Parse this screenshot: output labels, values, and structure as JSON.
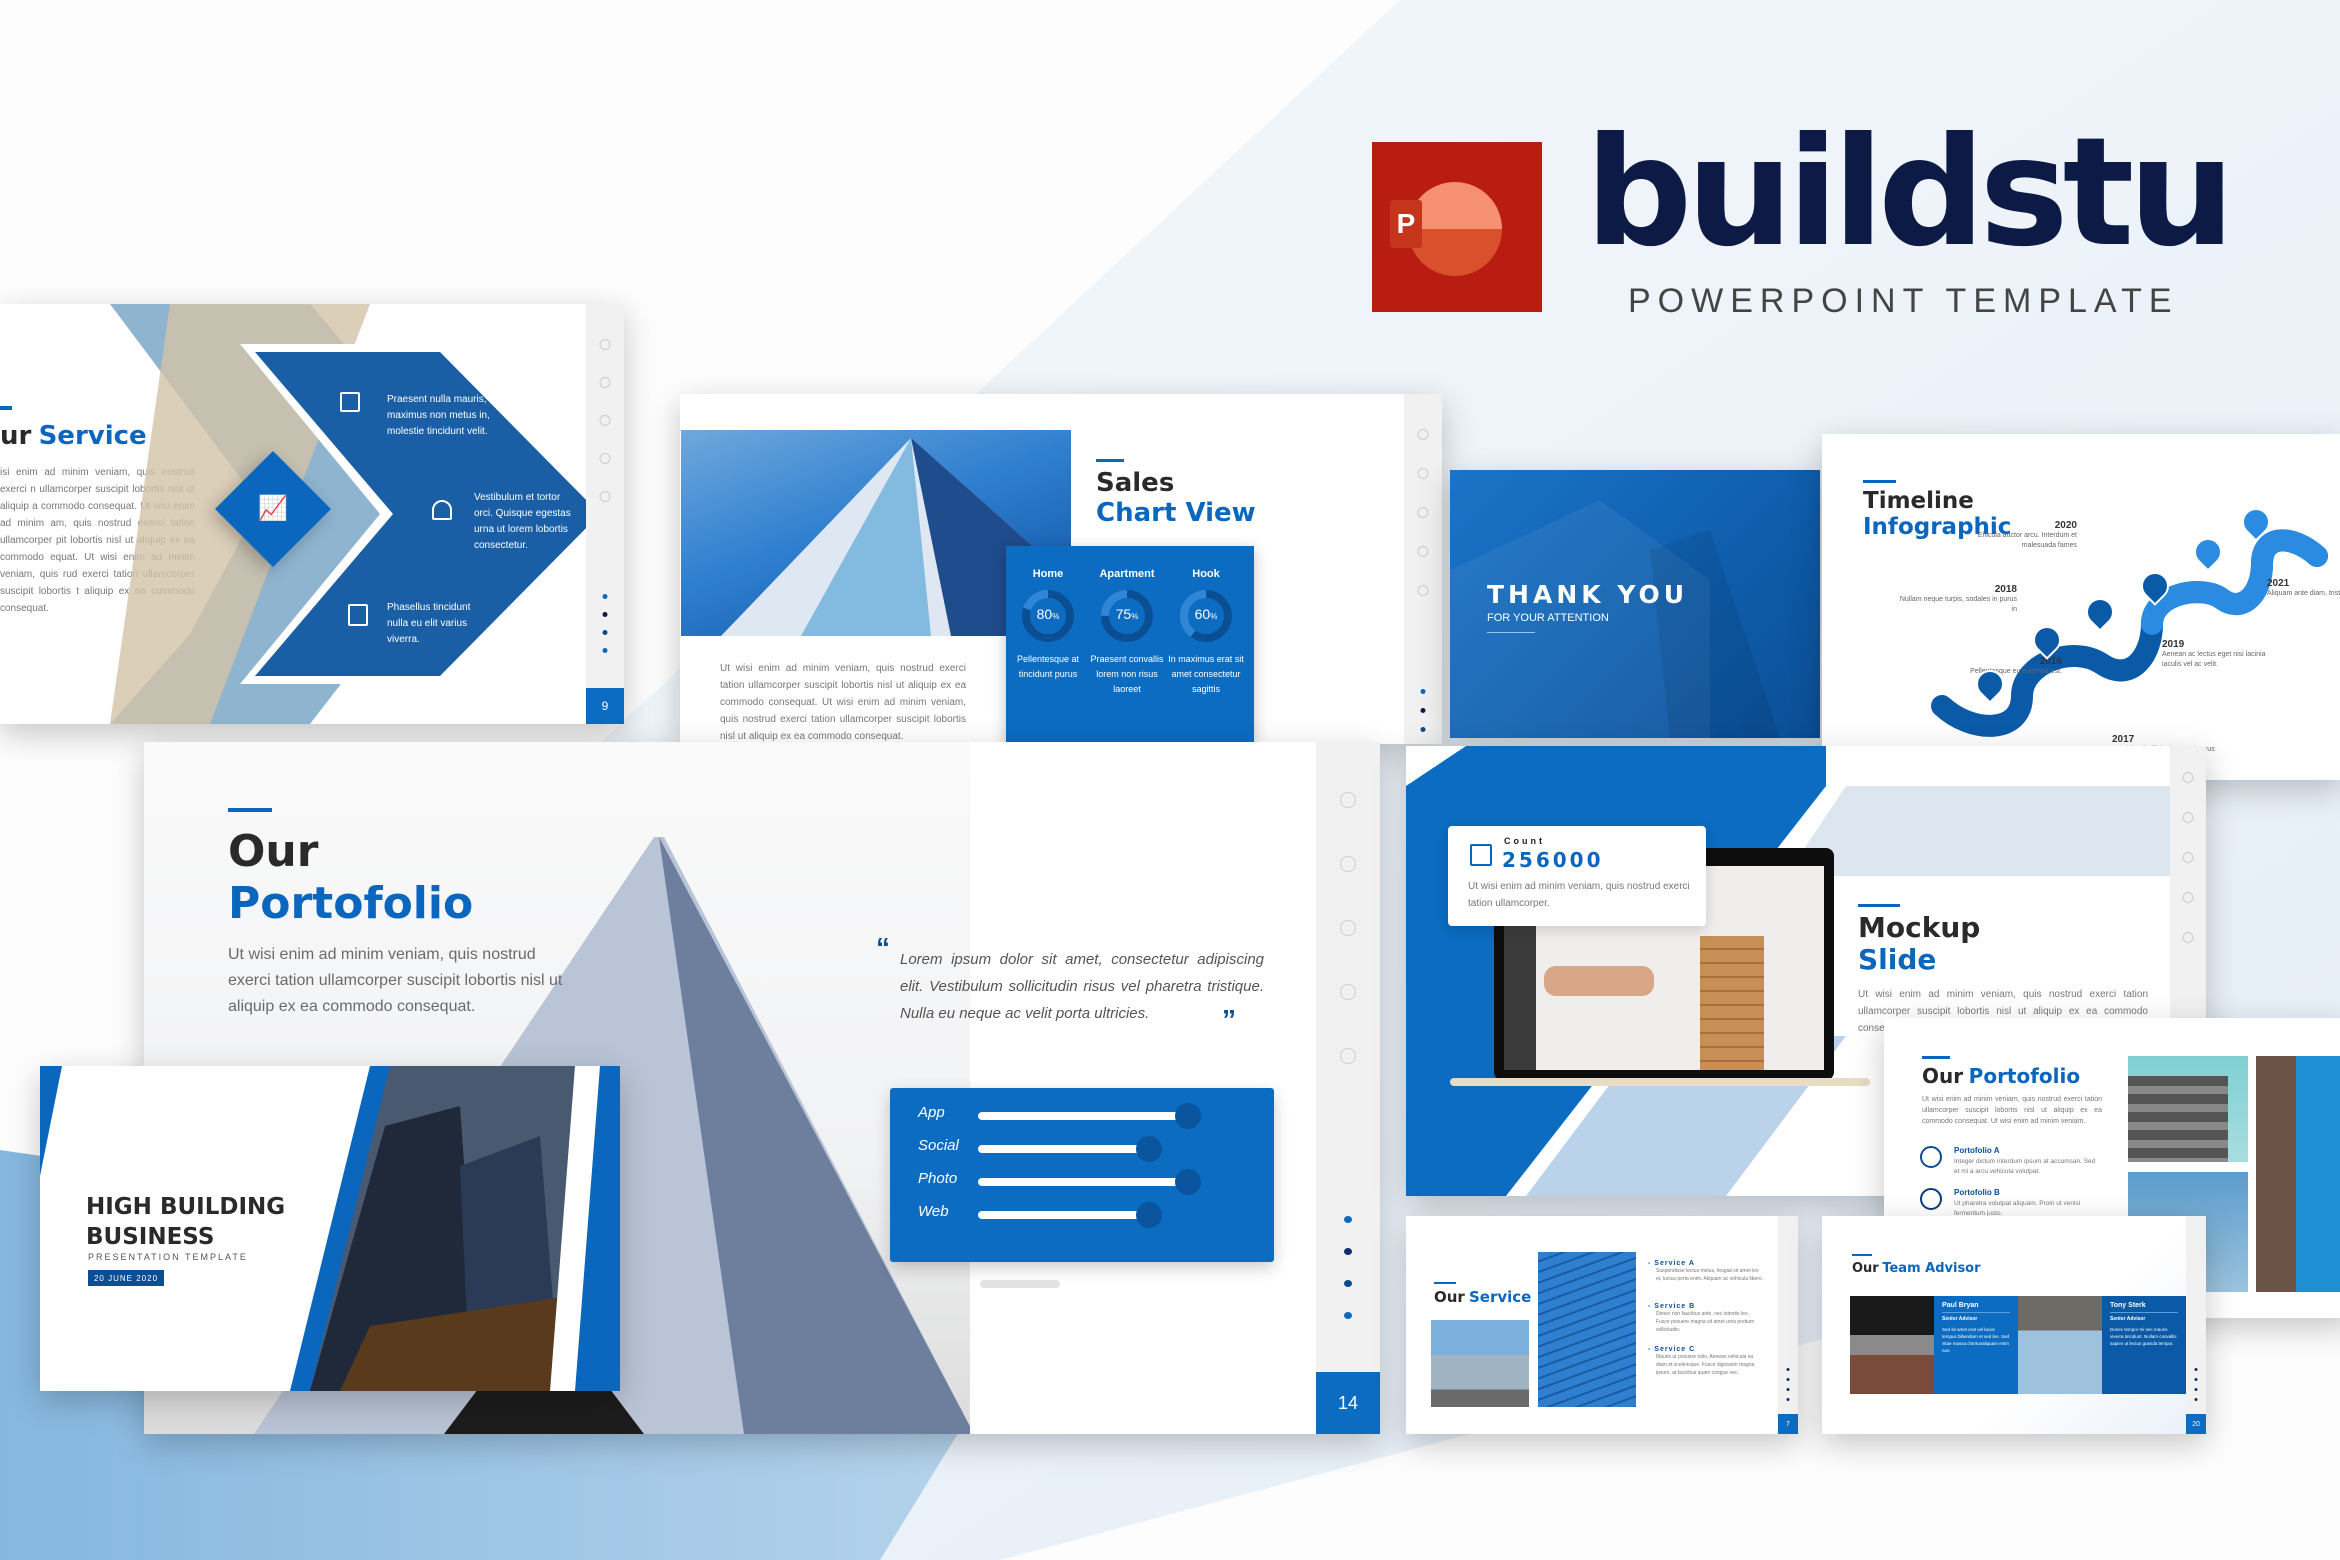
{
  "brand": {
    "app_icon": "powerpoint-icon",
    "app_icon_letter": "P",
    "name": "buildstu",
    "tagline": "POWERPOINT TEMPLATE",
    "colors": {
      "primary_blue": "#0b66be",
      "navy": "#0d1a45",
      "ppt_red": "#b91c10",
      "ppt_orange": "#f47b55"
    }
  },
  "slides": {
    "service_chevron": {
      "title_dark": "ur",
      "title_blue": "Service",
      "body": "isi enim ad minim veniam, quis nostrud exerci n ullamcorper suscipit lobortis nisl ut aliquip a commodo consequat. Ut wisi enim ad minim am, quis nostrud exerci tation ullamcorper pit lobortis nisl ut aliquip ex ea commodo equat. Ut wisi enim ad minim veniam, quis rud exerci tation ullamcorper suscipit lobortis t aliquip ex ea commodo consequat.",
      "features": [
        {
          "icon": "houses-icon",
          "text": "Praesent nulla mauris, maximus non metus in, molestie tincidunt velit."
        },
        {
          "icon": "house-search-icon",
          "text": "Vestibulum et tortor orci. Quisque egestas urna ut lorem lobortis consectetur."
        },
        {
          "icon": "location-doc-icon",
          "text": "Phasellus tincidunt nulla eu elit varius viverra."
        }
      ],
      "center_icon": "growth-chart-icon",
      "page_number": "9"
    },
    "sales_chart": {
      "title_dark": "Sales",
      "title_blue": "Chart View",
      "body": "Ut wisi enim ad minim veniam, quis nostrud exerci tation ullamcorper suscipit lobortis nisl ut aliquip ex ea commodo consequat. Ut wisi enim ad minim veniam, quis nostrud exerci tation ullamcorper suscipit lobortis nisl ut aliquip ex ea commodo consequat.",
      "gauges": [
        {
          "label": "Home",
          "value": 80,
          "display": "80",
          "unit": "%",
          "caption": "Pellentesque at tincidunt purus"
        },
        {
          "label": "Apartment",
          "value": 75,
          "display": "75",
          "unit": "%",
          "caption": "Praesent convallis lorem non risus laoreet"
        },
        {
          "label": "Hook",
          "value": 60,
          "display": "60",
          "unit": "%",
          "caption": "In maximus erat sit amet consectetur sagittis"
        }
      ]
    },
    "thank_you": {
      "title": "THANK YOU",
      "subtitle": "FOR YOUR ATTENTION"
    },
    "timeline": {
      "title_dark": "Timeline",
      "title_blue": "Infographic",
      "events": [
        {
          "year": "2016",
          "text": "Pellentesque eu euismod est.",
          "icon": "edit-doc-icon"
        },
        {
          "year": "2017",
          "text": "Curabitur facilisis risus sed purus blandit feugiat.",
          "icon": "house-search-icon"
        },
        {
          "year": "2018",
          "text": "Nullam neque turpis, sodales in purus in",
          "icon": "house-leaf-icon"
        },
        {
          "year": "2019",
          "text": "Aenean ac lectus eget nisi lacinia iaculis vel ac velit.",
          "icon": "home-icon"
        },
        {
          "year": "2020",
          "text": "Ehicula auctor arcu. Interdum et malesuada fames",
          "icon": "award-icon"
        },
        {
          "year": "2021",
          "text": "Aliquam ante diam, tristique.",
          "icon": "blueprint-icon"
        }
      ]
    },
    "portfolio_main": {
      "title_dark": "Our",
      "title_blue": "Portofolio",
      "body": "Ut wisi enim ad minim veniam, quis nostrud exerci tation ullamcorper suscipit lobortis nisl ut aliquip ex ea commodo consequat.",
      "quote": "Lorem ipsum dolor sit amet, consectetur adipiscing elit. Vestibulum sollicitudin risus vel pharetra tristique. Nulla eu neque ac velit porta ultricies.",
      "skills": [
        {
          "label": "App",
          "value": 0.9
        },
        {
          "label": "Social",
          "value": 0.73
        },
        {
          "label": "Photo",
          "value": 0.9
        },
        {
          "label": "Web",
          "value": 0.73
        }
      ],
      "social_icons": [
        "instagram-icon",
        "tumblr-icon",
        "pinterest-icon",
        "facebook-icon",
        "twitter-icon"
      ],
      "page_number": "14"
    },
    "cover": {
      "title_line1": "HIGH BUILDING",
      "title_line2": "BUSINESS",
      "subtitle": "PRESENTATION TEMPLATE",
      "date": "20 JUNE 2020"
    },
    "mockup": {
      "count_label": "Count",
      "count_value": "256000",
      "count_body": "Ut wisi enim ad minim veniam, quis nostrud exerci tation ullamcorper.",
      "title_dark": "Mockup",
      "title_blue": "Slide",
      "body": "Ut wisi enim ad minim veniam, quis nostrud exerci tation ullamcorper suscipit lobortis nisl ut aliquip ex ea commodo consequat."
    },
    "portfolio_small": {
      "title_dark": "Our",
      "title_blue": "Portofolio",
      "body": "Ut wisi enim ad minim veniam, quis nostrud exerci tation ullamcorper suscipit lobortis nisl ut aliquip ex ea commodo consequat. Ut wisi enim ad minim veniam.",
      "items": [
        {
          "title": "Portofolio A",
          "text": "Integer dictum interdum ipsum at accumsan. Sed et mi a arcu vehicula volutpat."
        },
        {
          "title": "Portofolio B",
          "text": "Ut pharetra volutpat aliquam. Proin ut venisi fermentum justo."
        }
      ]
    },
    "service_small": {
      "title_dark": "Our",
      "title_blue": "Service",
      "services": [
        {
          "title": "Service A",
          "text": "Suspendisse lectus metus, feugiat sit amet leo et, luctus porta enim. Aliquam ac vehicula libero."
        },
        {
          "title": "Service B",
          "text": "Donec non faucibus ante, nec lobortis leo. Fusce posuere magna sit amet urna pretium sollicitudin."
        },
        {
          "title": "Service C",
          "text": "Mauris ut posuere odio. Aenean vehicula eu diam et scelerisque. Fusce dignissim magna ipsum, at faucibus quam congue nec."
        }
      ],
      "page_number": "7"
    },
    "team": {
      "title_dark": "Our",
      "title_blue": "Team Advisor",
      "members": [
        {
          "name": "Paul Bryan",
          "role": "Senior Advisor",
          "bio": "Sed sit amet erat vel lacus tempus bibendum et sed leo. Sed vitae massa d'arrtuvaliquam enim non."
        },
        {
          "name": "Tony Sterk",
          "role": "Senior Advisor",
          "bio": "Donec tempor mi nec mauris viverra tincidunt. Nullam convallis sapien ut lectus gravida tempor."
        }
      ],
      "page_number": "20"
    }
  }
}
